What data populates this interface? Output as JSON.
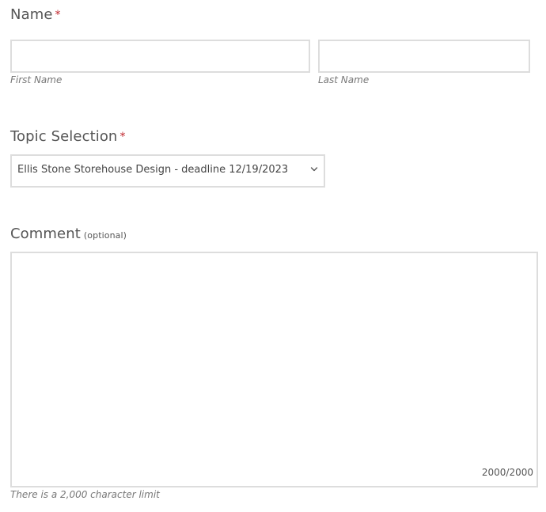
{
  "name_field": {
    "label": "Name",
    "required_mark": "*",
    "first_name": {
      "value": "",
      "placeholder": "",
      "sublabel": "First Name"
    },
    "last_name": {
      "value": "",
      "placeholder": "",
      "sublabel": "Last Name"
    }
  },
  "topic_field": {
    "label": "Topic Selection",
    "required_mark": "*",
    "selected_value": "Ellis Stone Storehouse Design - deadline 12/19/2023",
    "icon": "chevron-down-icon"
  },
  "comment_field": {
    "label": "Comment",
    "optional_note": "(optional)",
    "value": "",
    "placeholder": "",
    "counter": "2000/2000",
    "help_text": "There is a 2,000 character limit"
  },
  "colors": {
    "label_text": "#555555",
    "required_mark": "#c0262d",
    "input_border": "#dddddd",
    "sublabel_text": "#777777"
  }
}
